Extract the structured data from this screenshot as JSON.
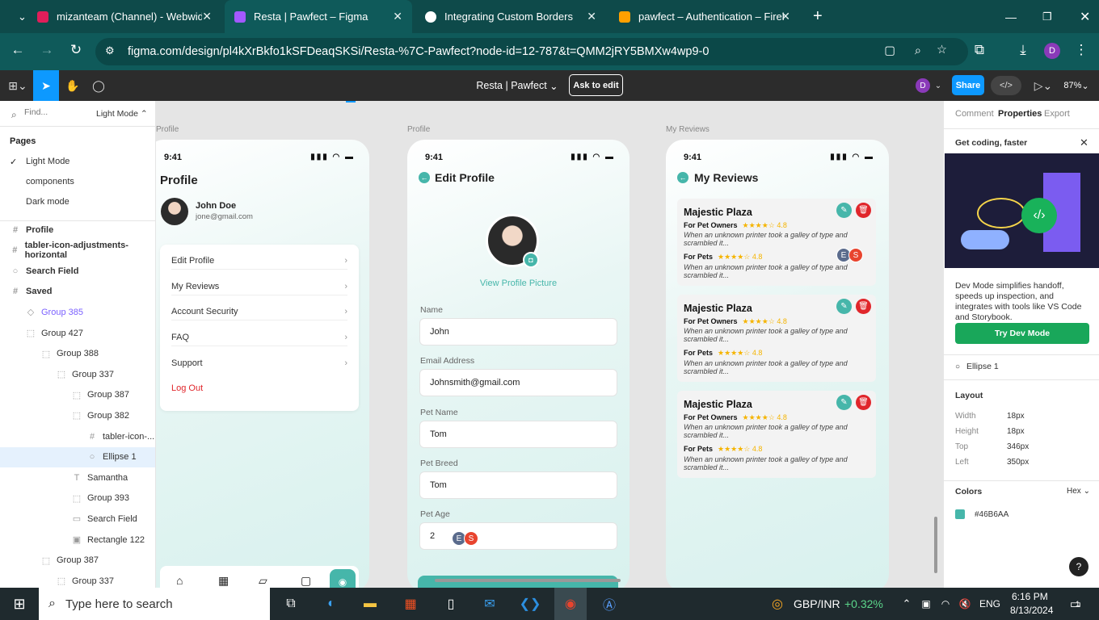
{
  "browser": {
    "tabs": [
      {
        "label": "mizanteam (Channel) - Webwid",
        "color": "#e01e5a"
      },
      {
        "label": "Resta | Pawfect – Figma",
        "color": "#a259ff"
      },
      {
        "label": "Integrating Custom Borders",
        "color": "#ffffff"
      },
      {
        "label": "pawfect – Authentication – Fireb",
        "color": "#ffa000"
      }
    ],
    "url": "figma.com/design/pl4kXrBkfo1kSFDeaqSKSi/Resta-%7C-Pawfect?node-id=12-787&t=QMM2jRY5BMXw4wp9-0",
    "profile_initial": "D"
  },
  "figma": {
    "file_title": "Resta | Pawfect",
    "ask_to_edit": "Ask to edit",
    "share": "Share",
    "zoom": "87%",
    "user_initial": "D"
  },
  "left_panel": {
    "find_placeholder": "Find...",
    "mode": "Light Mode",
    "pages_heading": "Pages",
    "pages": [
      "Light Mode",
      "components",
      "Dark mode"
    ],
    "layers": [
      {
        "label": "Profile",
        "icon": "#",
        "indent": 0
      },
      {
        "label": "tabler-icon-adjustments-horizontal",
        "icon": "#",
        "indent": 0
      },
      {
        "label": "Search Field",
        "icon": "○",
        "indent": 0
      },
      {
        "label": "Saved",
        "icon": "#",
        "indent": 0
      },
      {
        "label": "Group 385",
        "icon": "◇",
        "indent": 1
      },
      {
        "label": "Group 427",
        "icon": "⬚",
        "indent": 1
      },
      {
        "label": "Group 388",
        "icon": "⬚",
        "indent": 2
      },
      {
        "label": "Group 337",
        "icon": "⬚",
        "indent": 3
      },
      {
        "label": "Group 387",
        "icon": "⬚",
        "indent": 4
      },
      {
        "label": "Group 382",
        "icon": "⬚",
        "indent": 4
      },
      {
        "label": "tabler-icon-...",
        "icon": "#",
        "indent": 5
      },
      {
        "label": "Ellipse 1",
        "icon": "○",
        "indent": 5
      },
      {
        "label": "Samantha",
        "icon": "T",
        "indent": 4
      },
      {
        "label": "Group 393",
        "icon": "⬚",
        "indent": 4
      },
      {
        "label": "Search Field",
        "icon": "▭",
        "indent": 4
      },
      {
        "label": "Rectangle 122",
        "icon": "▣",
        "indent": 4
      },
      {
        "label": "Group 387",
        "icon": "⬚",
        "indent": 2
      },
      {
        "label": "Group 337",
        "icon": "⬚",
        "indent": 3
      }
    ]
  },
  "canvas": {
    "profile": {
      "label": "Profile",
      "time": "9:41",
      "title": "Profile",
      "name": "John Doe",
      "email": "jone@gmail.com",
      "menu": [
        "Edit Profile",
        "My Reviews",
        "Account Security",
        "FAQ",
        "Support"
      ],
      "logout": "Log Out"
    },
    "edit": {
      "label": "Profile",
      "time": "9:41",
      "title": "Edit Profile",
      "view_pic": "View Profile Picture",
      "fields": [
        {
          "label": "Name",
          "value": "John"
        },
        {
          "label": "Email Address",
          "value": "Johnsmith@gmail.com"
        },
        {
          "label": "Pet Name",
          "value": "Tom"
        },
        {
          "label": "Pet Breed",
          "value": "Tom"
        },
        {
          "label": "Pet Age",
          "value": "2"
        }
      ]
    },
    "reviews": {
      "label": "My Reviews",
      "time": "9:41",
      "title": "My Reviews",
      "cards": [
        {
          "title": "Majestic Plaza",
          "owners": "For Pet Owners",
          "pets": "For Pets",
          "rating1": "4.8",
          "rating2": "4.8",
          "text1": "When an unknown printer took a galley of type and scrambled it...",
          "text2": "When an unknown printer took a galley of type and scrambled it..."
        },
        {
          "title": "Majestic Plaza",
          "owners": "For Pet Owners",
          "pets": "For Pets",
          "rating1": "4.8",
          "rating2": "4.8",
          "text1": "When an unknown printer took a galley of type and scrambled it...",
          "text2": "When an unknown printer took a galley of type and scrambled it..."
        },
        {
          "title": "Majestic Plaza",
          "owners": "For Pet Owners",
          "pets": "For Pets",
          "rating1": "4.8",
          "rating2": "4.8",
          "text1": "When an unknown printer took a galley of type and scrambled it...",
          "text2": "When an unknown printer took a galley of type and scrambled it..."
        }
      ]
    },
    "cursors": [
      "E",
      "S"
    ],
    "accent": "#46B6AA"
  },
  "right_panel": {
    "tabs": [
      "Comment",
      "Properties",
      "Export"
    ],
    "promo_title": "Get coding, faster",
    "promo_text": "Dev Mode simplifies handoff, speeds up inspection, and integrates with tools like VS Code and Storybook.",
    "try_button": "Try Dev Mode",
    "selected": "Ellipse 1",
    "layout_heading": "Layout",
    "layout": [
      {
        "k": "Width",
        "v": "18px"
      },
      {
        "k": "Height",
        "v": "18px"
      },
      {
        "k": "Top",
        "v": "346px"
      },
      {
        "k": "Left",
        "v": "350px"
      }
    ],
    "colors_heading": "Colors",
    "color_mode": "Hex",
    "color_value": "#46B6AA"
  },
  "taskbar": {
    "search_placeholder": "Type here to search",
    "ticker": "GBP/INR",
    "ticker_change": "+0.32%",
    "lang": "ENG",
    "time": "6:16 PM",
    "date": "8/13/2024",
    "notif": "1"
  }
}
